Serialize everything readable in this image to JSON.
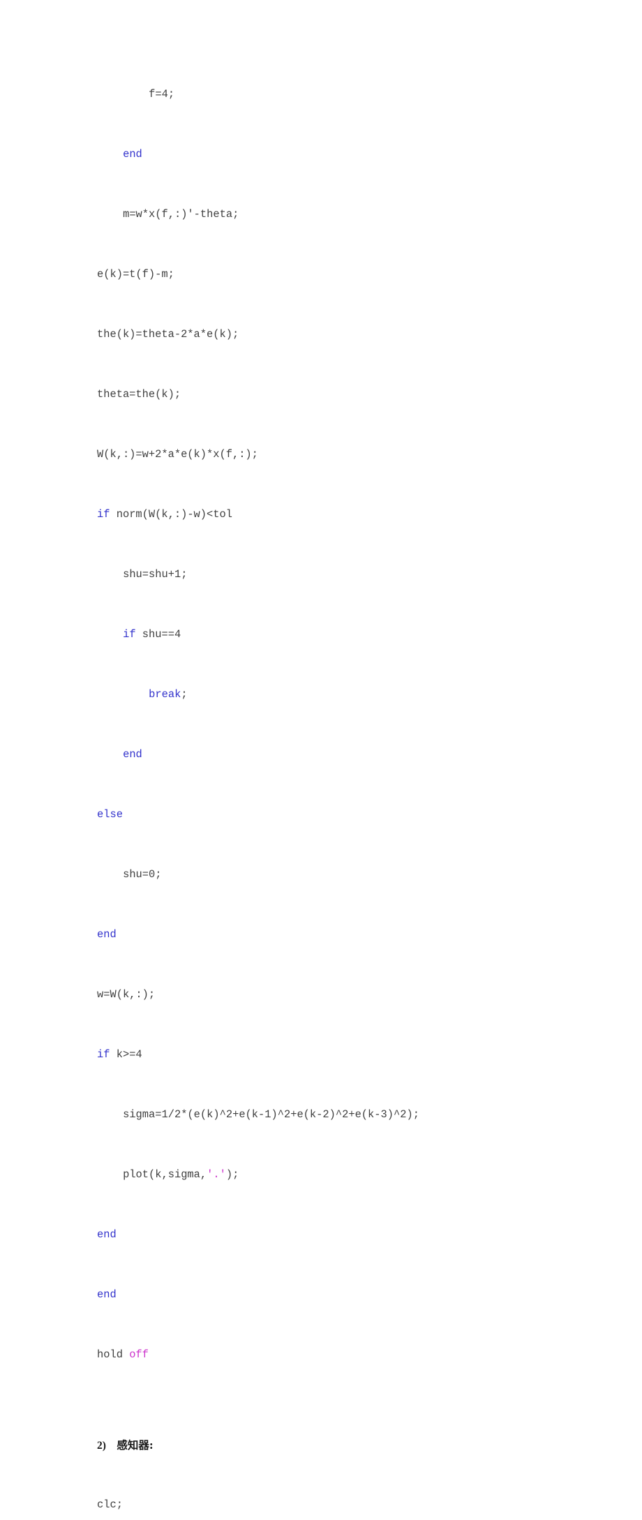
{
  "document": {
    "kind": "code-listing",
    "language": "MATLAB",
    "background_color": "#ffffff",
    "text_color": "#404040",
    "keyword_color": "#3333cc",
    "string_color": "#cc33cc",
    "heading_color": "#1a1a1a"
  },
  "lines": [
    {
      "id": "l1",
      "type": "code",
      "indent": 8,
      "segments": [
        {
          "text": "f=4;",
          "style": "plain"
        }
      ]
    },
    {
      "id": "l2",
      "type": "blank",
      "indent": 0,
      "segments": []
    },
    {
      "id": "l3",
      "type": "code",
      "indent": 4,
      "segments": [
        {
          "text": "end",
          "style": "keyword"
        }
      ]
    },
    {
      "id": "l4",
      "type": "blank",
      "indent": 0,
      "segments": []
    },
    {
      "id": "l5",
      "type": "code",
      "indent": 4,
      "segments": [
        {
          "text": "m=w*x(f,:)'-theta;",
          "style": "plain"
        }
      ]
    },
    {
      "id": "l6",
      "type": "blank",
      "indent": 0,
      "segments": []
    },
    {
      "id": "l7",
      "type": "code",
      "indent": 0,
      "segments": [
        {
          "text": "e(k)=t(f)-m;",
          "style": "plain"
        }
      ]
    },
    {
      "id": "l8",
      "type": "blank",
      "indent": 0,
      "segments": []
    },
    {
      "id": "l9",
      "type": "code",
      "indent": 0,
      "segments": [
        {
          "text": "the(k)=theta-2*a*e(k);",
          "style": "plain"
        }
      ]
    },
    {
      "id": "l10",
      "type": "blank",
      "indent": 0,
      "segments": []
    },
    {
      "id": "l11",
      "type": "code",
      "indent": 0,
      "segments": [
        {
          "text": "theta=the(k);",
          "style": "plain"
        }
      ]
    },
    {
      "id": "l12",
      "type": "blank",
      "indent": 0,
      "segments": []
    },
    {
      "id": "l13",
      "type": "code",
      "indent": 0,
      "segments": [
        {
          "text": "W(k,:)=w+2*a*e(k)*x(f,:);",
          "style": "plain"
        }
      ]
    },
    {
      "id": "l14",
      "type": "blank",
      "indent": 0,
      "segments": []
    },
    {
      "id": "l15",
      "type": "code",
      "indent": 0,
      "segments": [
        {
          "text": "if",
          "style": "keyword"
        },
        {
          "text": " norm(W(k,:)-w)<tol",
          "style": "plain"
        }
      ]
    },
    {
      "id": "l16",
      "type": "blank",
      "indent": 0,
      "segments": []
    },
    {
      "id": "l17",
      "type": "code",
      "indent": 4,
      "segments": [
        {
          "text": "shu=shu+1;",
          "style": "plain"
        }
      ]
    },
    {
      "id": "l18",
      "type": "blank",
      "indent": 0,
      "segments": []
    },
    {
      "id": "l19",
      "type": "code",
      "indent": 4,
      "segments": [
        {
          "text": "if",
          "style": "keyword"
        },
        {
          "text": " shu==4",
          "style": "plain"
        }
      ]
    },
    {
      "id": "l20",
      "type": "blank",
      "indent": 0,
      "segments": []
    },
    {
      "id": "l21",
      "type": "code",
      "indent": 8,
      "segments": [
        {
          "text": "break",
          "style": "keyword"
        },
        {
          "text": ";",
          "style": "plain"
        }
      ]
    },
    {
      "id": "l22",
      "type": "blank",
      "indent": 0,
      "segments": []
    },
    {
      "id": "l23",
      "type": "code",
      "indent": 4,
      "segments": [
        {
          "text": "end",
          "style": "keyword"
        }
      ]
    },
    {
      "id": "l24",
      "type": "blank",
      "indent": 0,
      "segments": []
    },
    {
      "id": "l25",
      "type": "code",
      "indent": 0,
      "segments": [
        {
          "text": "else",
          "style": "keyword"
        }
      ]
    },
    {
      "id": "l26",
      "type": "blank",
      "indent": 0,
      "segments": []
    },
    {
      "id": "l27",
      "type": "code",
      "indent": 4,
      "segments": [
        {
          "text": "shu=0;",
          "style": "plain"
        }
      ]
    },
    {
      "id": "l28",
      "type": "blank",
      "indent": 0,
      "segments": []
    },
    {
      "id": "l29",
      "type": "code",
      "indent": 0,
      "segments": [
        {
          "text": "end",
          "style": "keyword"
        }
      ]
    },
    {
      "id": "l30",
      "type": "blank",
      "indent": 0,
      "segments": []
    },
    {
      "id": "l31",
      "type": "code",
      "indent": 0,
      "segments": [
        {
          "text": "w=W(k,:);",
          "style": "plain"
        }
      ]
    },
    {
      "id": "l32",
      "type": "blank",
      "indent": 0,
      "segments": []
    },
    {
      "id": "l33",
      "type": "code",
      "indent": 0,
      "segments": [
        {
          "text": "if",
          "style": "keyword"
        },
        {
          "text": " k>=4",
          "style": "plain"
        }
      ]
    },
    {
      "id": "l34",
      "type": "blank",
      "indent": 0,
      "segments": []
    },
    {
      "id": "l35",
      "type": "code",
      "indent": 4,
      "segments": [
        {
          "text": "sigma=1/2*(e(k)^2+e(k-1)^2+e(k-2)^2+e(k-3)^2);",
          "style": "plain"
        }
      ]
    },
    {
      "id": "l36",
      "type": "blank",
      "indent": 0,
      "segments": []
    },
    {
      "id": "l37",
      "type": "code",
      "indent": 4,
      "segments": [
        {
          "text": "plot(k,sigma,",
          "style": "plain"
        },
        {
          "text": "'.'",
          "style": "string"
        },
        {
          "text": ");",
          "style": "plain"
        }
      ]
    },
    {
      "id": "l38",
      "type": "blank",
      "indent": 0,
      "segments": []
    },
    {
      "id": "l39",
      "type": "code",
      "indent": 0,
      "segments": [
        {
          "text": "end",
          "style": "keyword"
        }
      ]
    },
    {
      "id": "l40",
      "type": "blank",
      "indent": 0,
      "segments": []
    },
    {
      "id": "l41",
      "type": "code",
      "indent": 0,
      "segments": [
        {
          "text": "end",
          "style": "keyword"
        }
      ]
    },
    {
      "id": "l42",
      "type": "blank",
      "indent": 0,
      "segments": []
    },
    {
      "id": "l43",
      "type": "code",
      "indent": 0,
      "segments": [
        {
          "text": "hold ",
          "style": "plain"
        },
        {
          "text": "off",
          "style": "string"
        }
      ]
    },
    {
      "id": "l44",
      "type": "blank",
      "indent": 0,
      "segments": []
    },
    {
      "id": "l45",
      "type": "blank",
      "indent": 0,
      "segments": []
    },
    {
      "id": "l46",
      "type": "heading",
      "indent": 0,
      "segments": [
        {
          "text": "2)",
          "style": "heading-num"
        },
        {
          "text": "    ",
          "style": "heading-num"
        },
        {
          "text": "感知器:",
          "style": "heading-cjk"
        }
      ]
    },
    {
      "id": "l47",
      "type": "blank",
      "indent": 0,
      "segments": []
    },
    {
      "id": "l48",
      "type": "code",
      "indent": 0,
      "segments": [
        {
          "text": "clc;",
          "style": "plain"
        }
      ]
    }
  ]
}
